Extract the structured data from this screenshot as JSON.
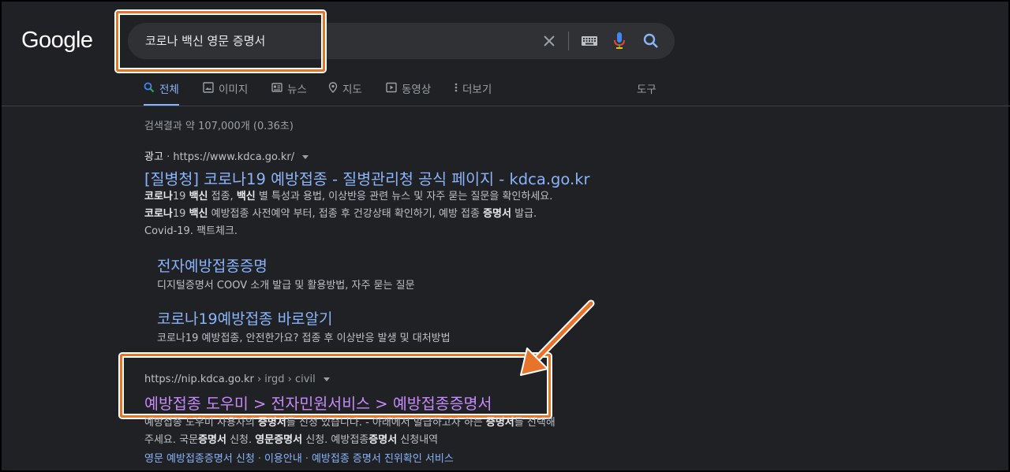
{
  "logo": "Google",
  "search": {
    "query": "코로나 백신 영문 증명서"
  },
  "tabs": [
    {
      "label": "전체",
      "icon": "search-icon"
    },
    {
      "label": "이미지",
      "icon": "image-icon"
    },
    {
      "label": "뉴스",
      "icon": "news-icon"
    },
    {
      "label": "지도",
      "icon": "map-pin-icon"
    },
    {
      "label": "동영상",
      "icon": "video-icon"
    },
    {
      "label": "더보기",
      "icon": "more-vert-icon"
    }
  ],
  "tools_label": "도구",
  "result_stats": "검색결과 약 107,000개 (0.36초)",
  "ad": {
    "badge": "광고",
    "url": "https://www.kdca.go.kr/",
    "title": "[질병청] 코로나19 예방접종 - 질병관리청 공식 페이지 - kdca.go.kr",
    "snippet": [
      [
        "코로나",
        "19 ",
        "백신",
        " 접종, ",
        "백신",
        " 별 특성과 용법, 이상반응 관련 뉴스 및 자주 묻는 질문을 확인하세요."
      ],
      [
        "코로나",
        "19 ",
        "백신",
        " 예방접종 사전예약 부터, 접종 후 건강상태 확인하기, 예방 접종 ",
        "증명서",
        " 발급."
      ],
      [
        "Covid-19. 팩트체크."
      ]
    ],
    "sitelinks": [
      {
        "title": "전자예방접종증명",
        "desc": "디지털증명서 COOV 소개 발급 및 활용방법, 자주 묻는 질문"
      },
      {
        "title": "코로나19예방접종 바로알기",
        "desc": "코로나19 예방접종, 안전한가요? 접종 후 이상반응 발생 및 대처방법"
      }
    ]
  },
  "organic": {
    "url_host": "https://nip.kdca.go.kr",
    "breadcrumb": " › irgd › civil",
    "title": "예방접종 도우미 > 전자민원서비스 > 예방접종증명서",
    "snippet": [
      [
        "예방접종 도우미 사용자의 ",
        "증명서",
        "를 신청 있습니다. - 아래에서 발급하고자 하는 ",
        "증명서",
        "를 선택해"
      ],
      [
        "주세요. 국문",
        "증명서",
        " 신청. ",
        "영문증명서",
        " 신청. 예방접종",
        "증명서",
        " 신청내역"
      ]
    ],
    "deep_links": [
      "영문 예방접종증명서 신청",
      "이용안내",
      "예방접종 증명서 진위확인 서비스"
    ],
    "deep_sep": "·"
  },
  "colors": {
    "background": "#202124",
    "link": "#8ab4f8",
    "visited_link": "#c58af9",
    "annotation": "#e8732b"
  }
}
